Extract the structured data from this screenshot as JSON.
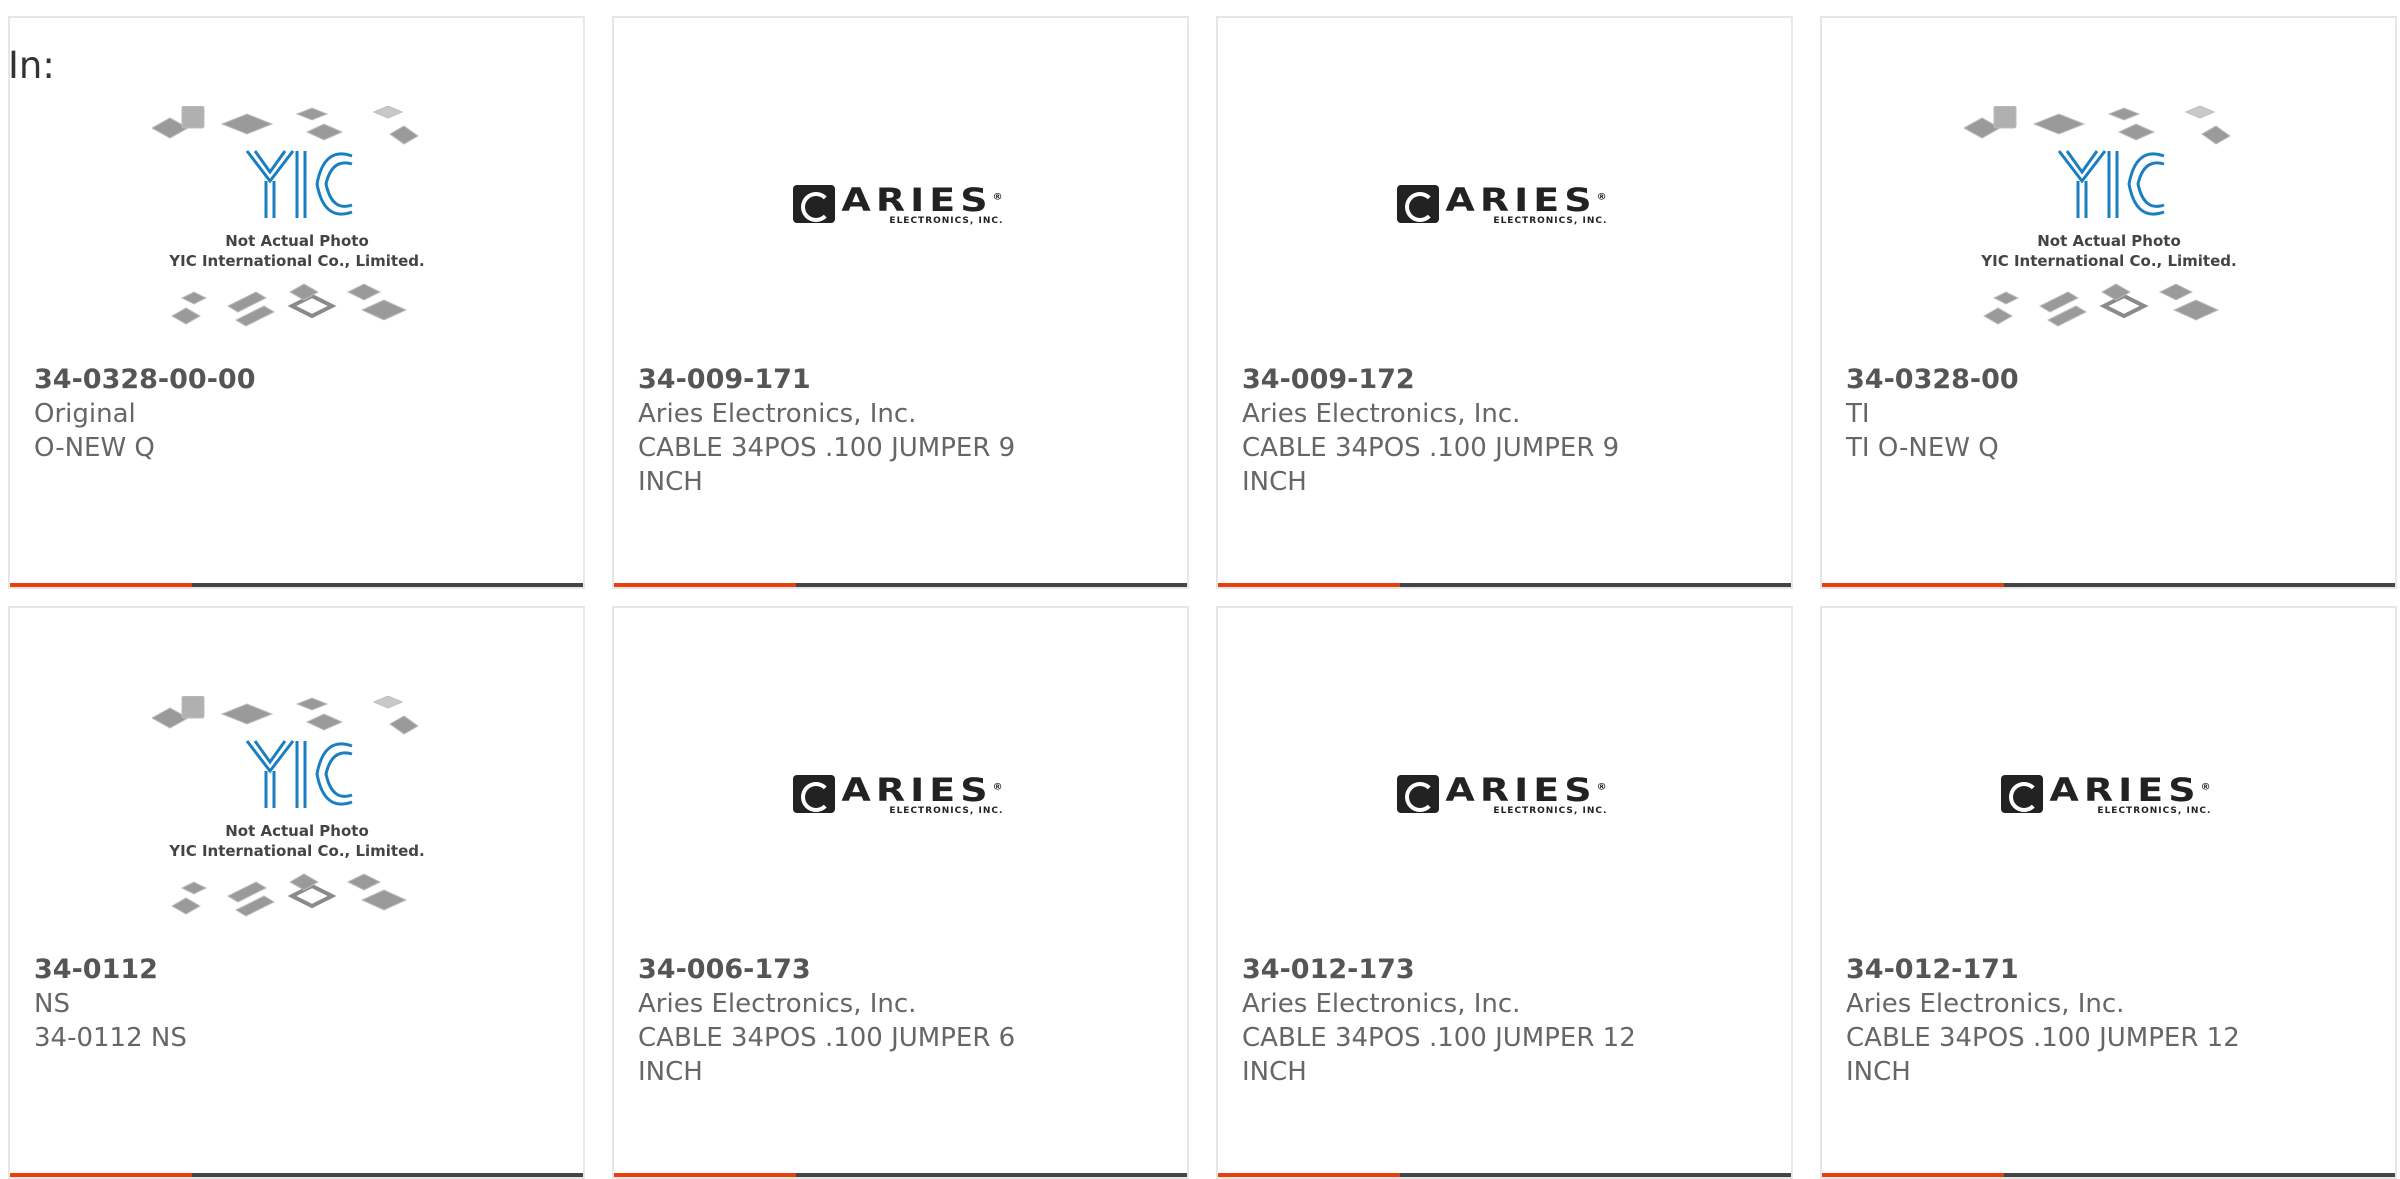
{
  "header": {
    "in_label": "In:"
  },
  "placeholder": {
    "logo_text": "YIC",
    "line1": "Not Actual Photo",
    "line2": "YIC International Co., Limited."
  },
  "aries_logo": {
    "word": "ARIES",
    "registered": "®",
    "sub": "ELECTRONICS, INC."
  },
  "colors": {
    "accent": "#e8400c",
    "bar": "#444444",
    "yic_blue": "#1a7fc1"
  },
  "products": [
    {
      "part": "34-0328-00-00",
      "maker": "Original",
      "desc": "O-NEW Q",
      "image": "yic-placeholder"
    },
    {
      "part": "34-009-171",
      "maker": "Aries Electronics, Inc.",
      "desc": "CABLE 34POS .100 JUMPER 9 INCH",
      "image": "aries-logo"
    },
    {
      "part": "34-009-172",
      "maker": "Aries Electronics, Inc.",
      "desc": "CABLE 34POS .100 JUMPER 9 INCH",
      "image": "aries-logo"
    },
    {
      "part": "34-0328-00",
      "maker": "TI",
      "desc": "TI O-NEW Q",
      "image": "yic-placeholder"
    },
    {
      "part": "34-0112",
      "maker": "NS",
      "desc": "34-0112 NS",
      "image": "yic-placeholder"
    },
    {
      "part": "34-006-173",
      "maker": "Aries Electronics, Inc.",
      "desc": "CABLE 34POS .100 JUMPER 6 INCH",
      "image": "aries-logo"
    },
    {
      "part": "34-012-173",
      "maker": "Aries Electronics, Inc.",
      "desc": "CABLE 34POS .100 JUMPER 12 INCH",
      "image": "aries-logo"
    },
    {
      "part": "34-012-171",
      "maker": "Aries Electronics, Inc.",
      "desc": "CABLE 34POS .100 JUMPER 12 INCH",
      "image": "aries-logo"
    }
  ]
}
